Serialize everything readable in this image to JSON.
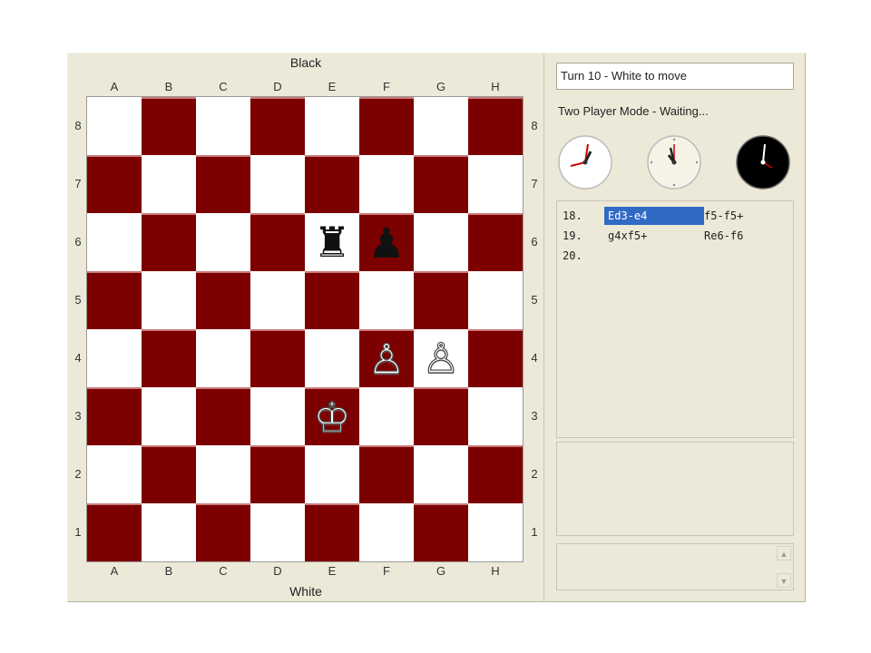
{
  "board_panel": {
    "top_side_label": "Black",
    "bottom_side_label": "White",
    "files": [
      "A",
      "B",
      "C",
      "D",
      "E",
      "F",
      "G",
      "H"
    ],
    "ranks": [
      "8",
      "7",
      "6",
      "5",
      "4",
      "3",
      "2",
      "1"
    ]
  },
  "pieces": [
    {
      "square": "e6",
      "color": "black",
      "type": "rook",
      "glyph": "♜"
    },
    {
      "square": "f6",
      "color": "black",
      "type": "pawn",
      "glyph": "♟"
    },
    {
      "square": "f4",
      "color": "white",
      "type": "pawn",
      "glyph": "♙"
    },
    {
      "square": "g4",
      "color": "white",
      "type": "pawn",
      "glyph": "♙"
    },
    {
      "square": "e3",
      "color": "white",
      "type": "king",
      "glyph": "♔"
    }
  ],
  "colors": {
    "dark_square": "#7d0000",
    "light_square": "#ffffff",
    "selection": "#316ac5"
  },
  "status": {
    "turn_text": "Turn 10 - White to move",
    "mode_text": "Two Player Mode - Waiting..."
  },
  "clocks": [
    {
      "name": "white-clock-icon",
      "face": "#ffffff",
      "hands": "#cc0000"
    },
    {
      "name": "game-clock-icon",
      "face": "#f6f3e6",
      "hands": "#222222"
    },
    {
      "name": "black-clock-icon",
      "face": "#000000",
      "hands": "#ffffff"
    }
  ],
  "moves": [
    {
      "num": "18.",
      "white": "Ed3-e4",
      "black": "f5-f5+",
      "selected": true
    },
    {
      "num": "19.",
      "white": "g4xf5+",
      "black": "Re6-f6",
      "selected": false
    },
    {
      "num": "20.",
      "white": "",
      "black": "",
      "selected": false
    }
  ]
}
